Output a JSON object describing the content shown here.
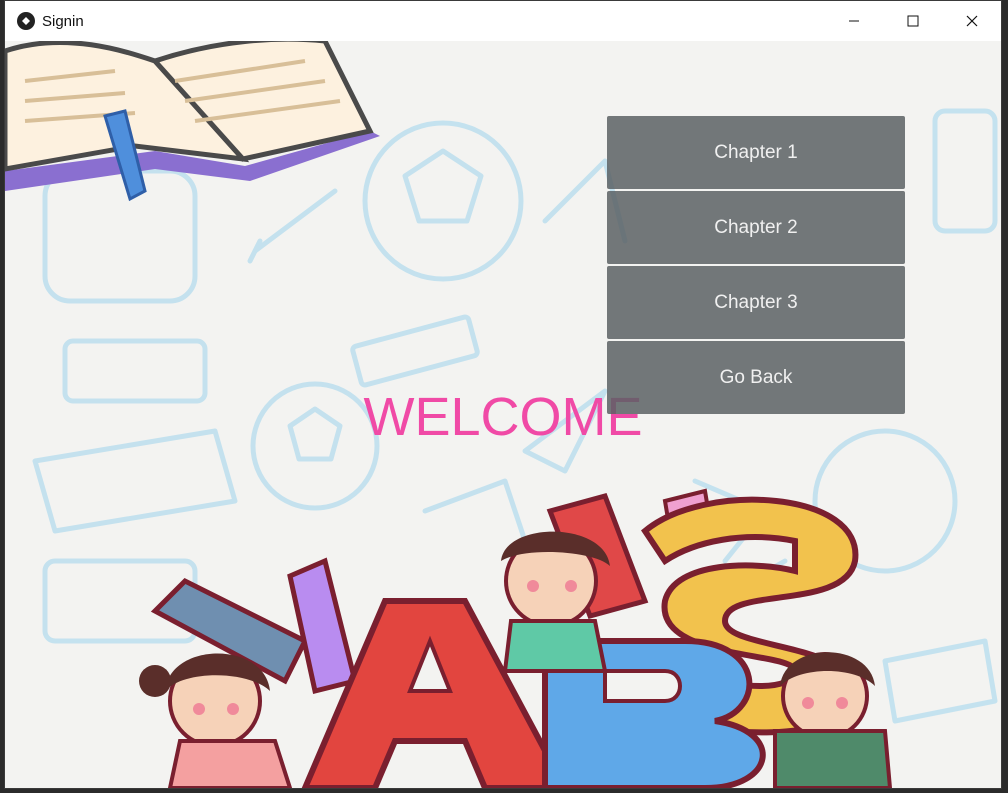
{
  "window": {
    "title": "Signin"
  },
  "main": {
    "welcome_text": "WELCOME",
    "buttons": [
      {
        "label": "Chapter 1"
      },
      {
        "label": "Chapter 2"
      },
      {
        "label": "Chapter 3"
      },
      {
        "label": "Go Back"
      }
    ]
  },
  "colors": {
    "welcome": "#f04aa6",
    "button_bg": "#5a6064",
    "button_text": "#f0f0f0",
    "background": "#f3f3f1",
    "doodle": "#bfe0ee"
  },
  "illustration": {
    "icons": [
      "open-book-icon",
      "school-doodles-background",
      "abc-kids-illustration"
    ],
    "letters": [
      "A",
      "B",
      "S"
    ]
  }
}
